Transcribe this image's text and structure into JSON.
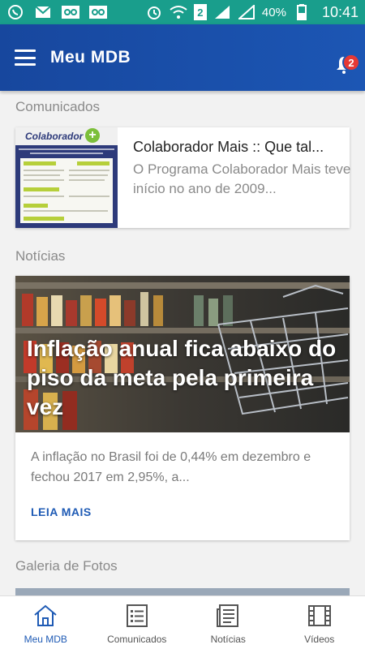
{
  "status_bar": {
    "battery": "40%",
    "time": "10:41",
    "sim": "2",
    "icons": [
      "whatsapp-icon",
      "mail-icon",
      "voicemail-icon",
      "voicemail-icon",
      "alarm-icon",
      "wifi-icon",
      "signal-icon",
      "signal-icon",
      "battery-icon"
    ]
  },
  "app_bar": {
    "title": "Meu MDB",
    "notification_count": "2"
  },
  "sections": {
    "comunicados": "Comunicados",
    "noticias": "Notícias",
    "galeria": "Galeria de Fotos"
  },
  "comunicado": {
    "title": "Colaborador Mais :: Que tal...",
    "description": "O Programa Colaborador Mais teve início no ano de 2009...",
    "thumb_logo": "Colaborador"
  },
  "noticia": {
    "headline": "Inflação anual fica abaixo do piso da meta pela primeira vez",
    "description": "A inflação no Brasil foi de 0,44% em dezembro e fechou 2017 em 2,95%, a...",
    "read_more": "LEIA MAIS"
  },
  "bottom_nav": [
    {
      "label": "Meu MDB",
      "icon": "home-icon",
      "active": true
    },
    {
      "label": "Comunicados",
      "icon": "list-icon",
      "active": false
    },
    {
      "label": "Notícias",
      "icon": "news-icon",
      "active": false
    },
    {
      "label": "Vídeos",
      "icon": "film-icon",
      "active": false
    }
  ],
  "colors": {
    "status_bar": "#199e8c",
    "app_bar": "#1c56b4",
    "accent": "#1f5bb5",
    "badge": "#e53935"
  }
}
